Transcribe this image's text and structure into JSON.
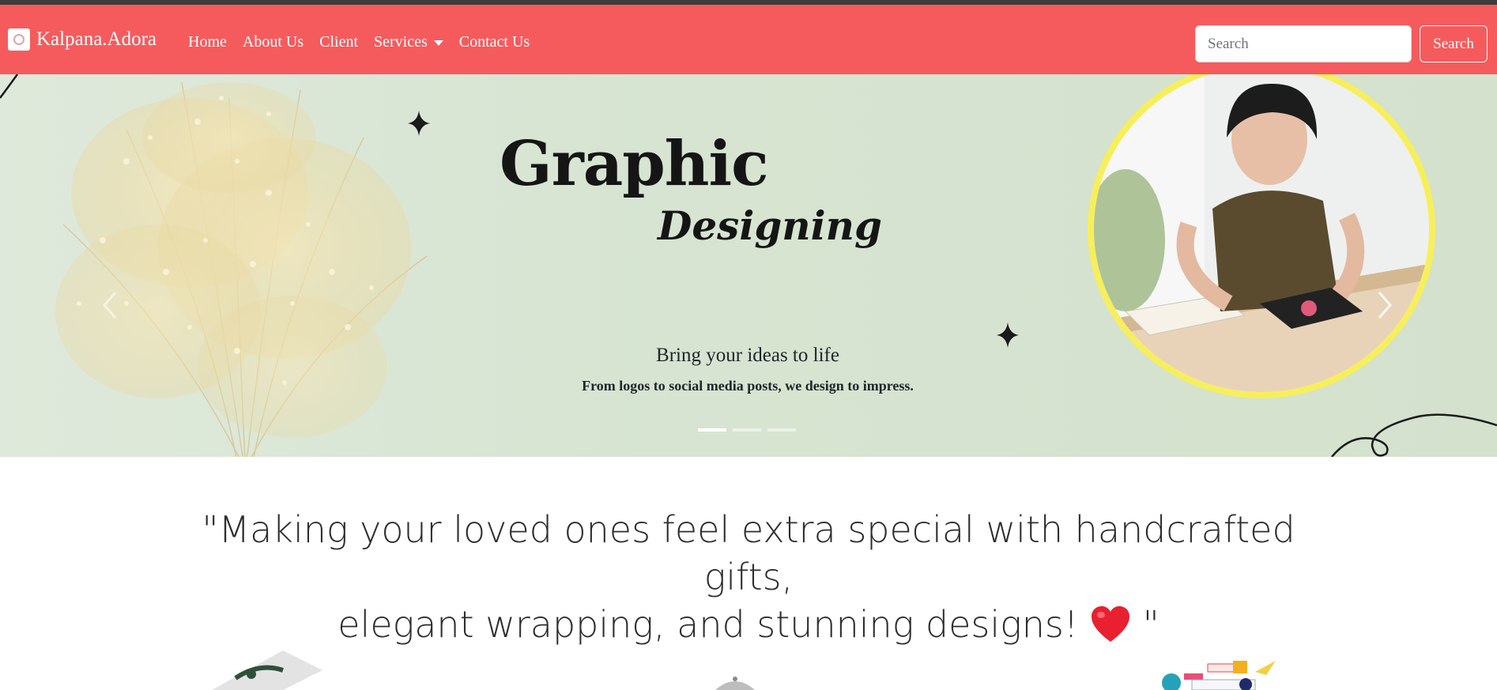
{
  "navbar": {
    "brand": "Kalpana.Adora",
    "links": [
      {
        "label": "Home"
      },
      {
        "label": "About Us"
      },
      {
        "label": "Client"
      },
      {
        "label": "Services"
      },
      {
        "label": "Contact Us"
      }
    ],
    "search_placeholder": "Search",
    "search_button": "Search",
    "bg_color": "#f55b5d"
  },
  "hero": {
    "title_line1": "Graphic",
    "title_line2": "Designing",
    "caption_heading": "Bring your ideas to life",
    "caption_text": "From logos to social media posts, we design to impress.",
    "slide_count": 3,
    "active_slide": 1,
    "bg_color": "#d6e4d1",
    "ring_color": "#f7ef5a"
  },
  "quote": {
    "line1": "\"Making your loved ones feel extra special with handcrafted gifts,",
    "line2": "elegant wrapping, and stunning designs!",
    "end": "\"",
    "emoji": "heart-icon"
  }
}
